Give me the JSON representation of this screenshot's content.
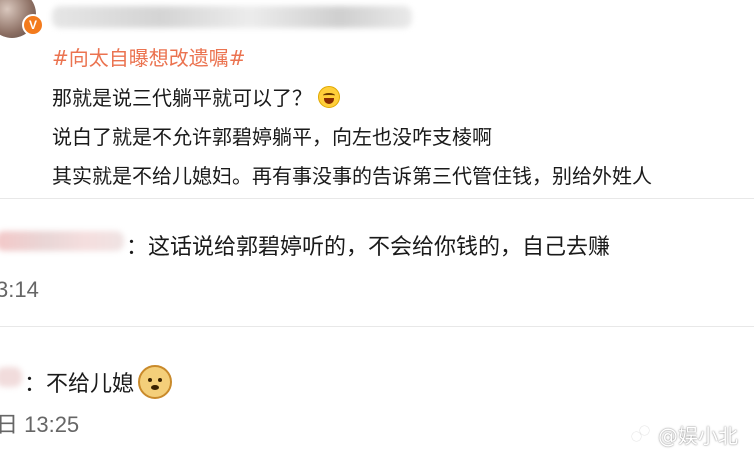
{
  "post": {
    "hashtag": "#向太自曝想改遗嘱#",
    "lines": [
      "那就是说三代躺平就可以了？",
      "说白了就是不允许郭碧婷躺平，向左也没咋支棱啊",
      "其实就是不给儿媳妇。再有事没事的告诉第三代管住钱，别给外姓人"
    ],
    "laugh_emoji": "laughing-tears-emoji",
    "verified_badge": "V",
    "accent_color": "#eb7350"
  },
  "replies": [
    {
      "text": "：这话说给郭碧婷听的，不会给你钱的，自己去赚",
      "time": "3:14"
    },
    {
      "text": "：不给儿媳",
      "emoji": "doge-emoji",
      "time": "日 13:25"
    }
  ],
  "watermark": {
    "text": "@娱小北",
    "icon": "weibo-logo-icon"
  }
}
